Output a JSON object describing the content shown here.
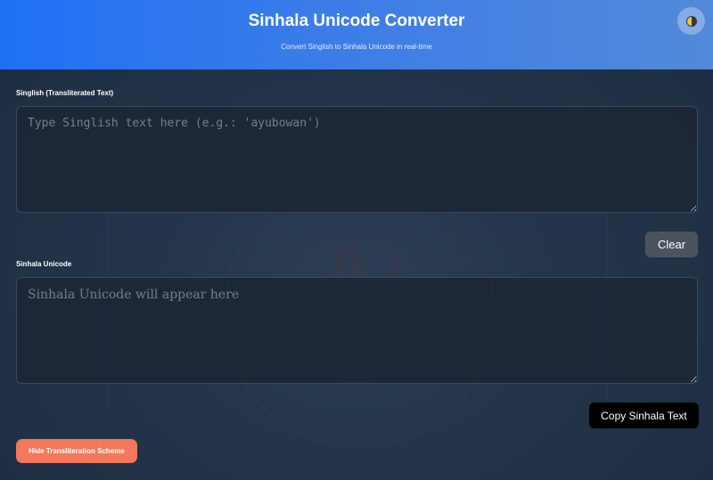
{
  "header": {
    "title": "Sinhala Unicode Converter",
    "subtitle": "Convert Singlish to Sinhala Unicode in real-time",
    "theme_toggle_icon": "theme-toggle-icon"
  },
  "singlish": {
    "label": "Singlish (Transliterated Text)",
    "value": "",
    "placeholder": "Type Singlish text here (e.g.: 'ayubowan')"
  },
  "sinhala": {
    "label": "Sinhala Unicode",
    "value": "",
    "placeholder": "Sinhala Unicode will appear here"
  },
  "buttons": {
    "clear_label": "Clear",
    "copy_label": "Copy Sinhala Text",
    "scheme_label": "Hide Transliteration Scheme"
  },
  "colors": {
    "header_gradient_start": "#1f70f5",
    "header_gradient_end": "#5289d9",
    "scheme_button": "#f4785c",
    "copy_button": "#000000",
    "clear_button": "#4a535e",
    "background": "#24354b"
  }
}
